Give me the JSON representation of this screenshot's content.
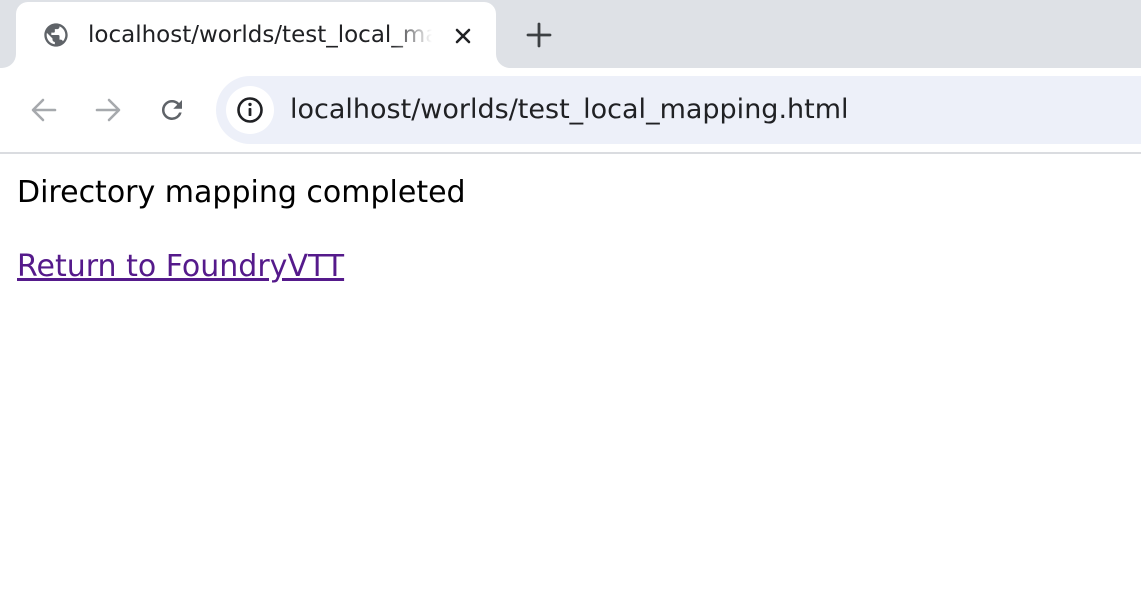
{
  "browser": {
    "tab": {
      "title": "localhost/worlds/test_local_mapping.html",
      "favicon": "globe-icon"
    },
    "new_tab_icon": "plus-icon",
    "close_tab_icon": "close-icon",
    "nav": {
      "back_icon": "back-arrow-icon",
      "forward_icon": "forward-arrow-icon",
      "reload_icon": "reload-icon"
    },
    "address_bar": {
      "site_info_icon": "info-icon",
      "url": "localhost/worlds/test_local_mapping.html"
    },
    "colors": {
      "tabstrip": "#dee1e6",
      "omnibox": "#edf0f9",
      "visited_link": "#551a8b"
    }
  },
  "page": {
    "message": "Directory mapping completed",
    "link_text": "Return to FoundryVTT"
  }
}
